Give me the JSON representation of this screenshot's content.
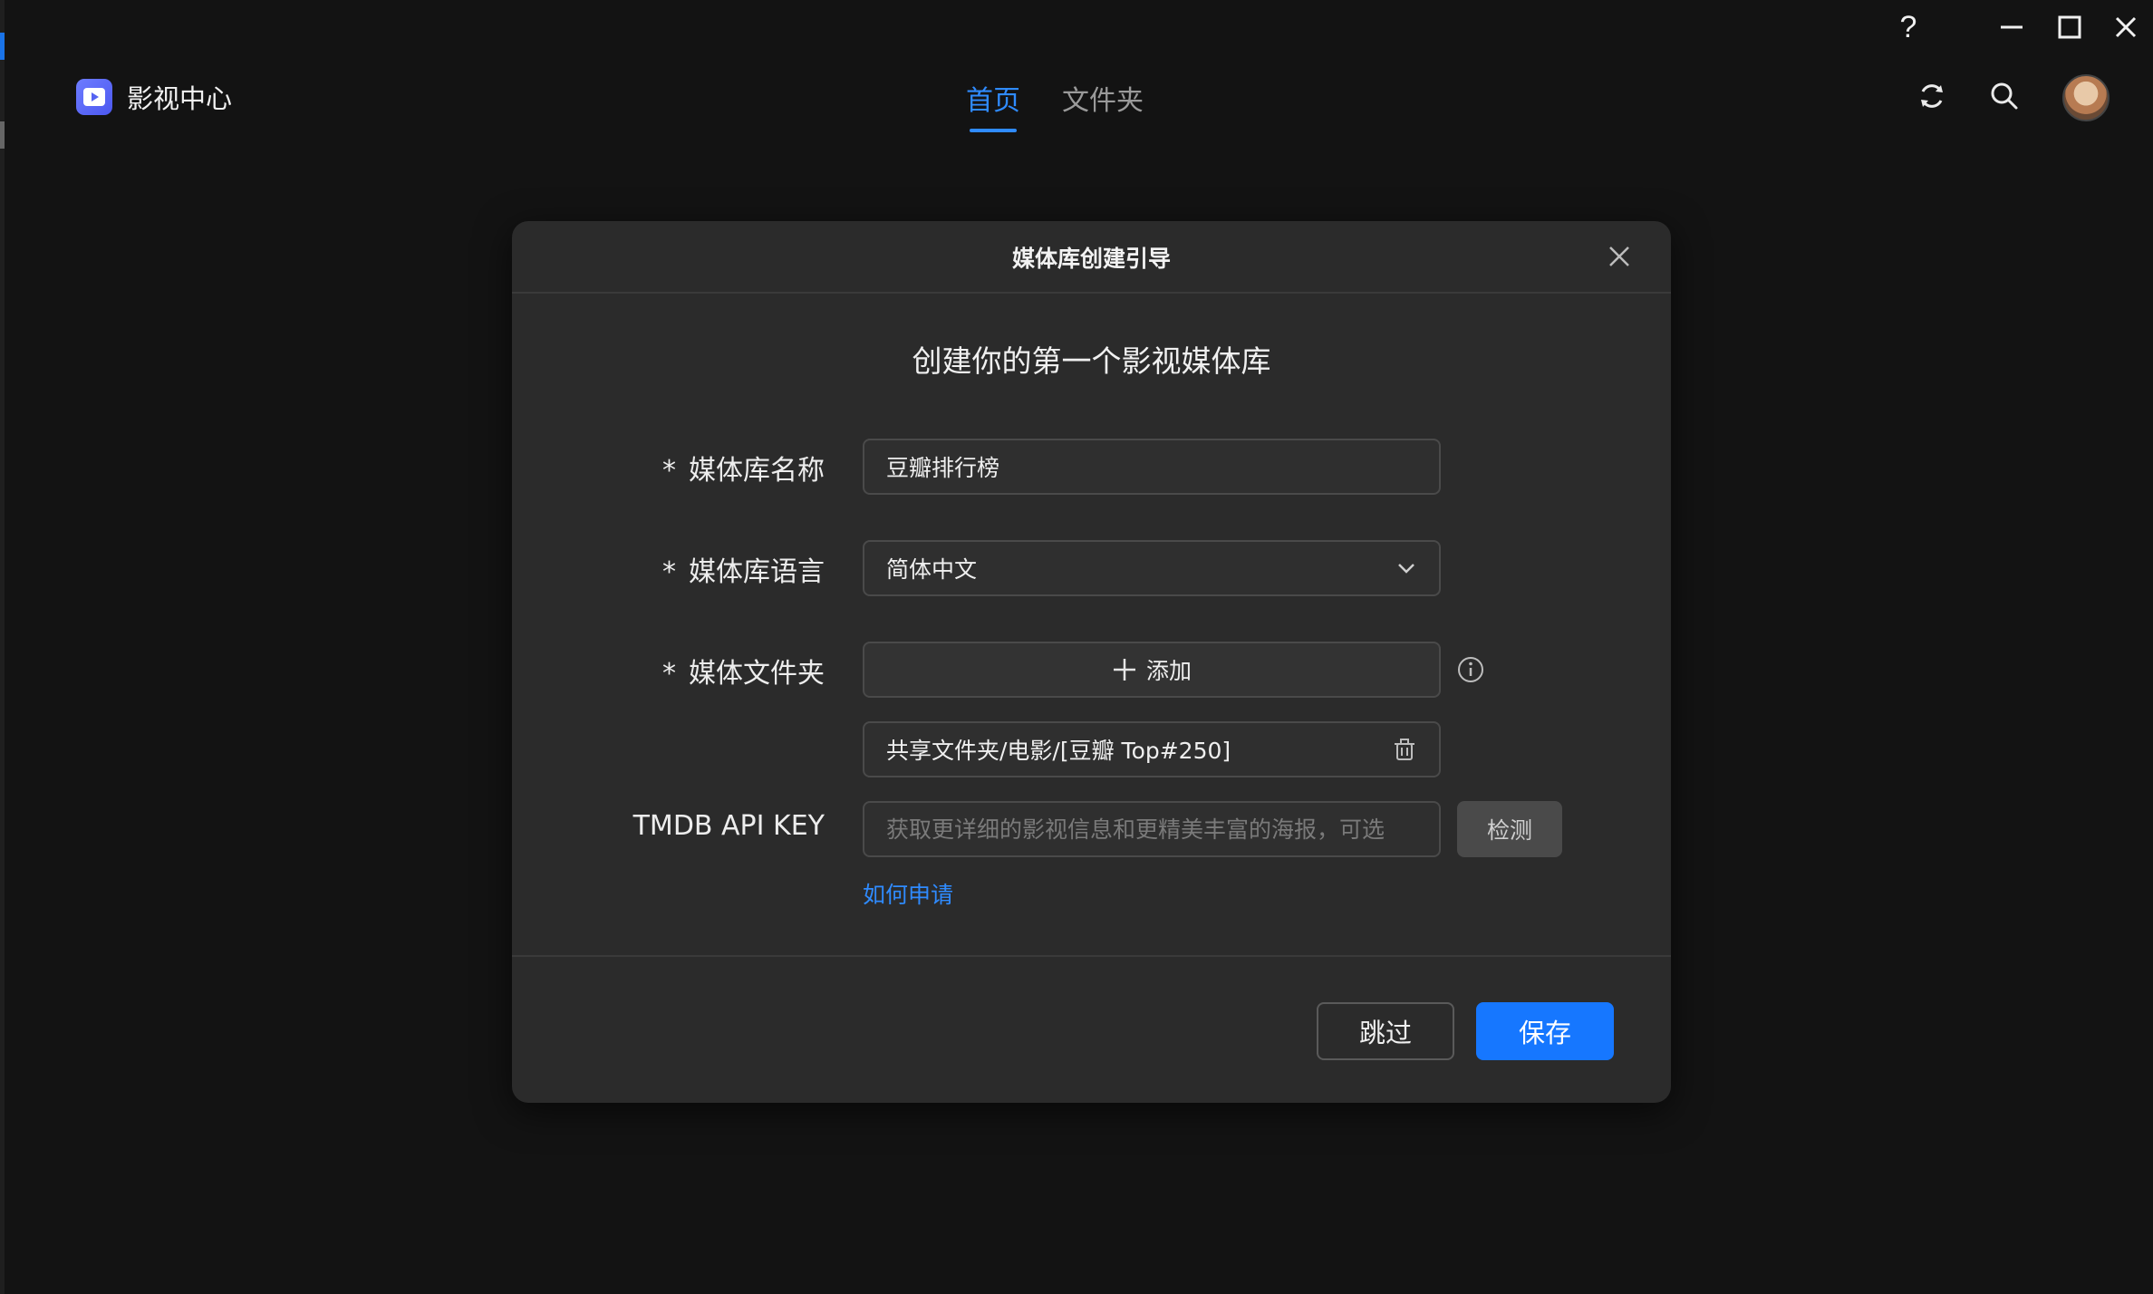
{
  "window_controls": {
    "help_label": "?"
  },
  "header": {
    "app_title": "影视中心",
    "tabs": [
      {
        "label": "首页",
        "active": true
      },
      {
        "label": "文件夹",
        "active": false
      }
    ]
  },
  "dialog": {
    "title": "媒体库创建引导",
    "subtitle": "创建你的第一个影视媒体库",
    "required_mark": "*",
    "name": {
      "label": "媒体库名称",
      "value": "豆瓣排行榜"
    },
    "language": {
      "label": "媒体库语言",
      "value": "简体中文"
    },
    "folder": {
      "label": "媒体文件夹",
      "add_label": "添加",
      "paths": [
        "共享文件夹/电影/[豆瓣 Top#250]"
      ]
    },
    "api_key": {
      "label": "TMDB API KEY",
      "placeholder": "获取更详细的影视信息和更精美丰富的海报，可选",
      "detect_label": "检测",
      "howto_link": "如何申请"
    },
    "skip_label": "跳过",
    "save_label": "保存"
  },
  "colors": {
    "accent": "#1677ff",
    "link": "#2f8bff",
    "background": "#131313",
    "dialog_bg": "#2b2b2b"
  }
}
